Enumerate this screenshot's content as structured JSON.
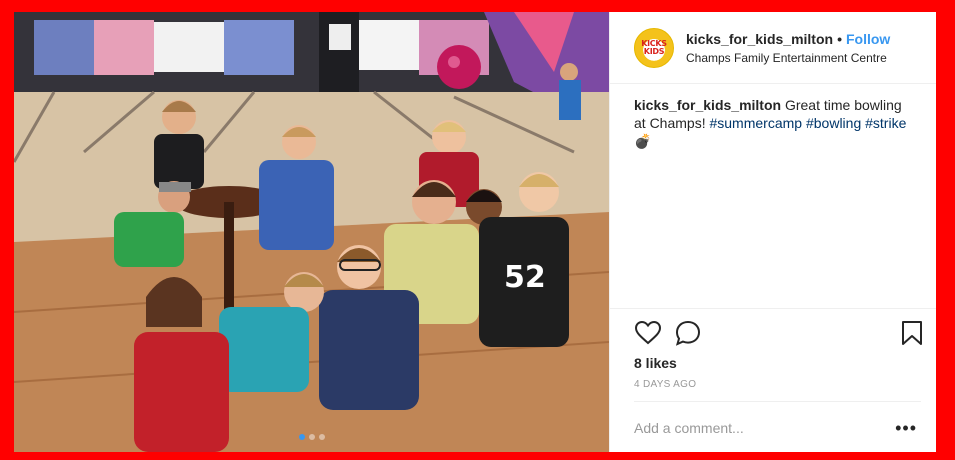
{
  "post": {
    "username": "kicks_for_kids_milton",
    "bullet": "•",
    "follow_label": "Follow",
    "location": "Champs Family Entertainment Centre",
    "avatar_text": "KICKS KIDS",
    "caption": {
      "username": "kicks_for_kids_milton",
      "text": " Great time bowling at Champs! ",
      "tags": [
        "#summercamp",
        "#bowling",
        "#strike"
      ],
      "emoji": "💣"
    },
    "likes": "8 likes",
    "time": "4 DAYS AGO",
    "comment_placeholder": "Add a comment...",
    "more_label": "•••",
    "carousel": {
      "count": 3,
      "active_index": 0
    }
  },
  "photo": {
    "scene": "children posing in a bowling alley",
    "jersey_number": "52"
  },
  "colors": {
    "frame_border": "#ff0000",
    "follow_blue": "#3897f0",
    "hashtag_blue": "#003569",
    "meta_gray": "#999999"
  },
  "icons": [
    "heart-icon",
    "comment-icon",
    "bookmark-icon",
    "more-options-icon"
  ]
}
